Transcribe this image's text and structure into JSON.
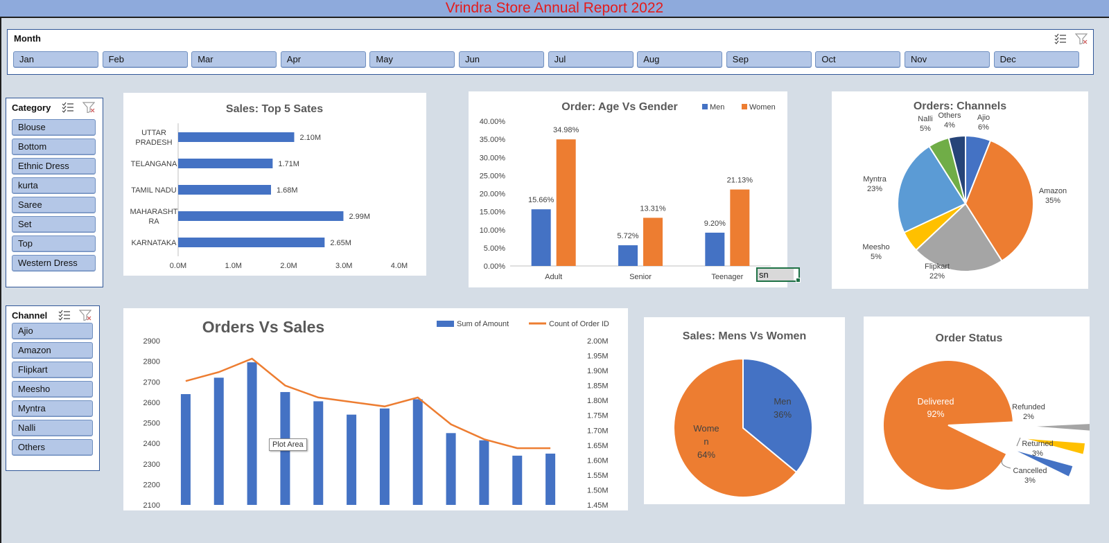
{
  "report_title": "Vrindra Store Annual Report 2022",
  "month_slicer": {
    "title": "Month",
    "months": [
      "Jan",
      "Feb",
      "Mar",
      "Apr",
      "May",
      "Jun",
      "Jul",
      "Aug",
      "Sep",
      "Oct",
      "Nov",
      "Dec"
    ]
  },
  "category_slicer": {
    "title": "Category",
    "items": [
      "Blouse",
      "Bottom",
      "Ethnic Dress",
      "kurta",
      "Saree",
      "Set",
      "Top",
      "Western Dress"
    ]
  },
  "channel_slicer": {
    "title": "Channel",
    "items": [
      "Ajio",
      "Amazon",
      "Flipkart",
      "Meesho",
      "Myntra",
      "Nalli",
      "Others"
    ]
  },
  "cell_value": "sn",
  "tooltip": "Plot Area",
  "colors": {
    "blue": "#4472c4",
    "orange": "#ed7d31",
    "gray": "#a5a5a5",
    "gold": "#ffc000",
    "lightblue": "#5b9bd5",
    "green": "#70ad47",
    "navy": "#264478",
    "title_red": "#e41b1b"
  },
  "chart_data": [
    {
      "id": "top5",
      "type": "bar",
      "orientation": "horizontal",
      "title": "Sales: Top 5 Sates",
      "categories": [
        "UTTAR PRADESH",
        "TELANGANA",
        "TAMIL NADU",
        "MAHARASHTRA",
        "KARNATAKA"
      ],
      "category_lines": [
        [
          "UTTAR",
          "PRADESH"
        ],
        [
          "TELANGANA"
        ],
        [
          "TAMIL NADU"
        ],
        [
          "MAHARASHT",
          "RA"
        ],
        [
          "KARNATAKA"
        ]
      ],
      "values": [
        2.1,
        1.71,
        1.68,
        2.99,
        2.65
      ],
      "data_labels": [
        "2.10M",
        "1.71M",
        "1.68M",
        "2.99M",
        "2.65M"
      ],
      "xlim": [
        0,
        4
      ],
      "x_ticks": [
        "0.0M",
        "1.0M",
        "2.0M",
        "3.0M",
        "4.0M"
      ]
    },
    {
      "id": "agegender",
      "type": "bar",
      "title": "Order: Age Vs Gender",
      "categories": [
        "Adult",
        "Senior",
        "Teenager"
      ],
      "series": [
        {
          "name": "Men",
          "values": [
            15.66,
            5.72,
            9.2
          ],
          "labels": [
            "15.66%",
            "5.72%",
            "9.20%"
          ]
        },
        {
          "name": "Women",
          "values": [
            34.98,
            13.31,
            21.13
          ],
          "labels": [
            "34.98%",
            "13.31%",
            "21.13%"
          ]
        }
      ],
      "ylim": [
        0,
        40
      ],
      "y_ticks": [
        "0.00%",
        "5.00%",
        "10.00%",
        "15.00%",
        "20.00%",
        "25.00%",
        "30.00%",
        "35.00%",
        "40.00%"
      ],
      "legend": "top-right"
    },
    {
      "id": "channels",
      "type": "pie",
      "title": "Orders: Channels",
      "slices": [
        {
          "name": "Ajio",
          "value": 6,
          "label": "6%"
        },
        {
          "name": "Amazon",
          "value": 35,
          "label": "35%"
        },
        {
          "name": "Flipkart",
          "value": 22,
          "label": "22%"
        },
        {
          "name": "Meesho",
          "value": 5,
          "label": "5%"
        },
        {
          "name": "Myntra",
          "value": 23,
          "label": "23%"
        },
        {
          "name": "Nalli",
          "value": 5,
          "label": "5%"
        },
        {
          "name": "Others",
          "value": 4,
          "label": "4%"
        }
      ]
    },
    {
      "id": "ordersales",
      "type": "bar",
      "title": "Orders Vs Sales",
      "series": [
        {
          "name": "Sum of Amount",
          "type": "bar",
          "axis": "left",
          "values": [
            2640,
            2720,
            2795,
            2650,
            2605,
            2540,
            2570,
            2615,
            2450,
            2415,
            2340,
            2350
          ]
        },
        {
          "name": "Count of Order ID",
          "type": "line",
          "axis": "right",
          "values": [
            1.865,
            1.895,
            1.94,
            1.85,
            1.81,
            1.795,
            1.78,
            1.81,
            1.72,
            1.67,
            1.64,
            1.64
          ]
        }
      ],
      "ylim_left": [
        2100,
        2900
      ],
      "ylim_right": [
        1.45,
        2.0
      ],
      "y_ticks_left": [
        "2100",
        "2200",
        "2300",
        "2400",
        "2500",
        "2600",
        "2700",
        "2800",
        "2900"
      ],
      "y_ticks_right": [
        "1.45M",
        "1.50M",
        "1.55M",
        "1.60M",
        "1.65M",
        "1.70M",
        "1.75M",
        "1.80M",
        "1.85M",
        "1.90M",
        "1.95M",
        "2.00M"
      ],
      "legend": "top-right"
    },
    {
      "id": "menwomen",
      "type": "pie",
      "title": "Sales: Mens Vs Women",
      "slices": [
        {
          "name": "Men",
          "value": 36,
          "label": "36%"
        },
        {
          "name": "Women",
          "value": 64,
          "label": "64%"
        }
      ],
      "name_lines": {
        "Men": [
          "Men"
        ],
        "Women": [
          "Wome",
          "n"
        ]
      }
    },
    {
      "id": "status",
      "type": "pie",
      "title": "Order Status",
      "slices": [
        {
          "name": "Delivered",
          "value": 92,
          "label": "92%"
        },
        {
          "name": "Refunded",
          "value": 2,
          "label": "2%"
        },
        {
          "name": "Returned",
          "value": 3,
          "label": "3%"
        },
        {
          "name": "Cancelled",
          "value": 3,
          "label": "3%"
        }
      ]
    }
  ]
}
